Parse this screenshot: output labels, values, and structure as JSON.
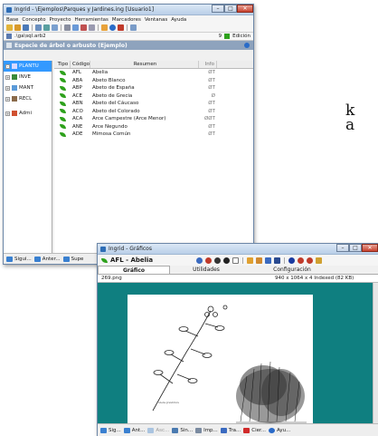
{
  "side_text": [
    "k",
    "a"
  ],
  "win1": {
    "title": "Ingrid - \\Ejemplos\\Parques y Jardines.ing [Usuario1]",
    "menu": [
      "Base",
      "Concepto",
      "Proyecto",
      "Herramientas",
      "Marcadores",
      "Ventanas",
      "Ayuda"
    ],
    "path": ".\\ga\\sql.arb2",
    "count": "9",
    "edition": "Edición",
    "header": "Especie de árbol o arbusto (Ejemplo)",
    "tree": [
      {
        "label": "PLANTU",
        "expander": "-"
      },
      {
        "label": "INVE",
        "expander": "+"
      },
      {
        "label": "MANT",
        "expander": "+"
      },
      {
        "label": "RECL",
        "expander": "+"
      },
      {
        "label": "Admi",
        "expander": "+"
      }
    ],
    "columns": [
      "Tipo",
      "Código",
      "Resumen",
      "Info"
    ],
    "rows": [
      {
        "code": "AFL",
        "summary": "Abelia",
        "info": "ØT"
      },
      {
        "code": "ABA",
        "summary": "Abeto Blanco",
        "info": "ØT"
      },
      {
        "code": "ABP",
        "summary": "Abeto de España",
        "info": "ØT"
      },
      {
        "code": "ACE",
        "summary": "Abeto de Grecia",
        "info": "Ø"
      },
      {
        "code": "ABN",
        "summary": "Abeto del Cáucaso",
        "info": "ØT"
      },
      {
        "code": "ACO",
        "summary": "Abeto del Colorado",
        "info": "ØT"
      },
      {
        "code": "ACA",
        "summary": "Arce Campestre (Arce Menor)",
        "info": "ØØT"
      },
      {
        "code": "ANE",
        "summary": "Arce Negundo",
        "info": "ØT"
      },
      {
        "code": "ADE",
        "summary": "Mimosa Común",
        "info": "ØT"
      }
    ],
    "status": [
      "Sigui...",
      "Anter...",
      "Supe"
    ]
  },
  "win2": {
    "title": "Ingrid - Gráficos",
    "record": "AFL - Abelia",
    "tabs": [
      "Gráfico",
      "Utilidades",
      "Configuración"
    ],
    "file": "269.png",
    "file_info": "940 x 1064 x 4 Indexed (82 KB)",
    "plate_caption": "Abelia grandiflora",
    "status": [
      "Sig...",
      "Ant...",
      "Asc...",
      "Sin...",
      "Imp...",
      "Tra...",
      "Cier...",
      "Ayu..."
    ]
  },
  "colors": {
    "teal": "#0f7f80",
    "header": "#8ea3bd",
    "selection": "#3399ff",
    "leaf": "#2ea11c"
  }
}
